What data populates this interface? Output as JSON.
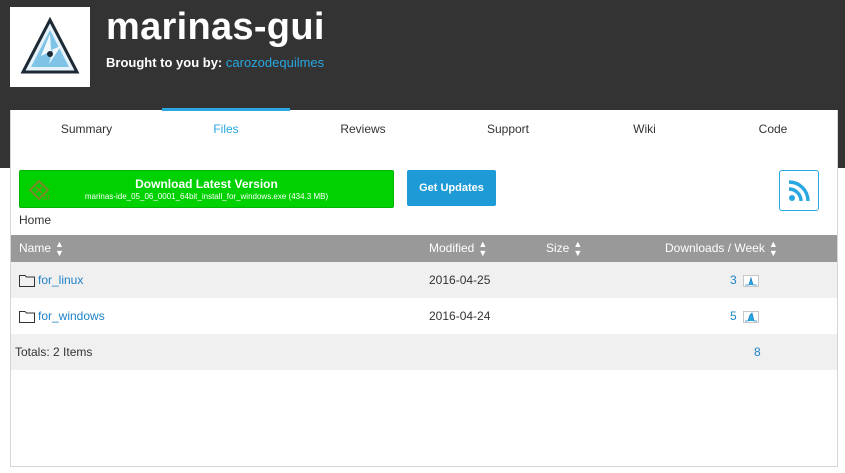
{
  "project": {
    "title": "marinas-gui",
    "byline_prefix": "Brought to you by:",
    "author": "carozodequilmes"
  },
  "tabs": [
    {
      "label": "Summary",
      "active": false
    },
    {
      "label": "Files",
      "active": true
    },
    {
      "label": "Reviews",
      "active": false
    },
    {
      "label": "Support",
      "active": false
    },
    {
      "label": "Wiki",
      "active": false
    },
    {
      "label": "Code",
      "active": false
    }
  ],
  "download": {
    "title": "Download Latest Version",
    "file": "marinas-ide_05_06_0001_64bit_install_for_windows.exe (434.3 MB)"
  },
  "updates_label": "Get Updates",
  "breadcrumb": "Home",
  "table": {
    "columns": [
      "Name",
      "Modified",
      "Size",
      "Downloads / Week"
    ],
    "rows": [
      {
        "name": "for_linux",
        "modified": "2016-04-25",
        "size": "",
        "downloads": "3"
      },
      {
        "name": "for_windows",
        "modified": "2016-04-24",
        "size": "",
        "downloads": "5"
      }
    ],
    "totals_label": "Totals: 2 Items",
    "totals_downloads": "8"
  },
  "colors": {
    "header_bg": "#333333",
    "accent": "#29a7e1",
    "download_green": "#00d100",
    "updates_blue": "#1e9ad6",
    "table_header": "#999999"
  },
  "icons": [
    "project-logo",
    "sourceforge-icon",
    "rss-icon",
    "sort-icon",
    "folder-icon",
    "sparkline-icon"
  ]
}
